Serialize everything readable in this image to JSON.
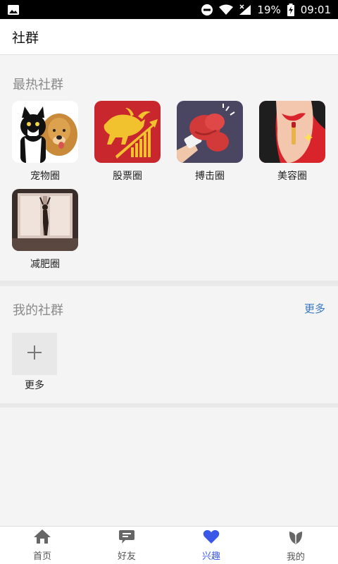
{
  "status_bar": {
    "battery": "19%",
    "time": "09:01"
  },
  "header": {
    "title": "社群"
  },
  "hot": {
    "title": "最热社群",
    "items": [
      {
        "label": "宠物圈",
        "icon": "pets-image"
      },
      {
        "label": "股票圈",
        "icon": "bull-chart-image"
      },
      {
        "label": "搏击圈",
        "icon": "boxing-glove-image"
      },
      {
        "label": "美容圈",
        "icon": "lipstick-image"
      },
      {
        "label": "减肥圈",
        "icon": "fitness-silhouette-image"
      }
    ]
  },
  "mine": {
    "title": "我的社群",
    "more_label": "更多",
    "add_label": "更多"
  },
  "bottom_nav": {
    "items": [
      {
        "label": "首页",
        "icon": "home-icon"
      },
      {
        "label": "好友",
        "icon": "chat-icon"
      },
      {
        "label": "兴趣",
        "icon": "heart-icon",
        "active": true
      },
      {
        "label": "我的",
        "icon": "leaf-icon"
      }
    ]
  },
  "colors": {
    "accent": "#3a57e8",
    "link": "#3a78c2",
    "stock_red": "#c8282d"
  }
}
